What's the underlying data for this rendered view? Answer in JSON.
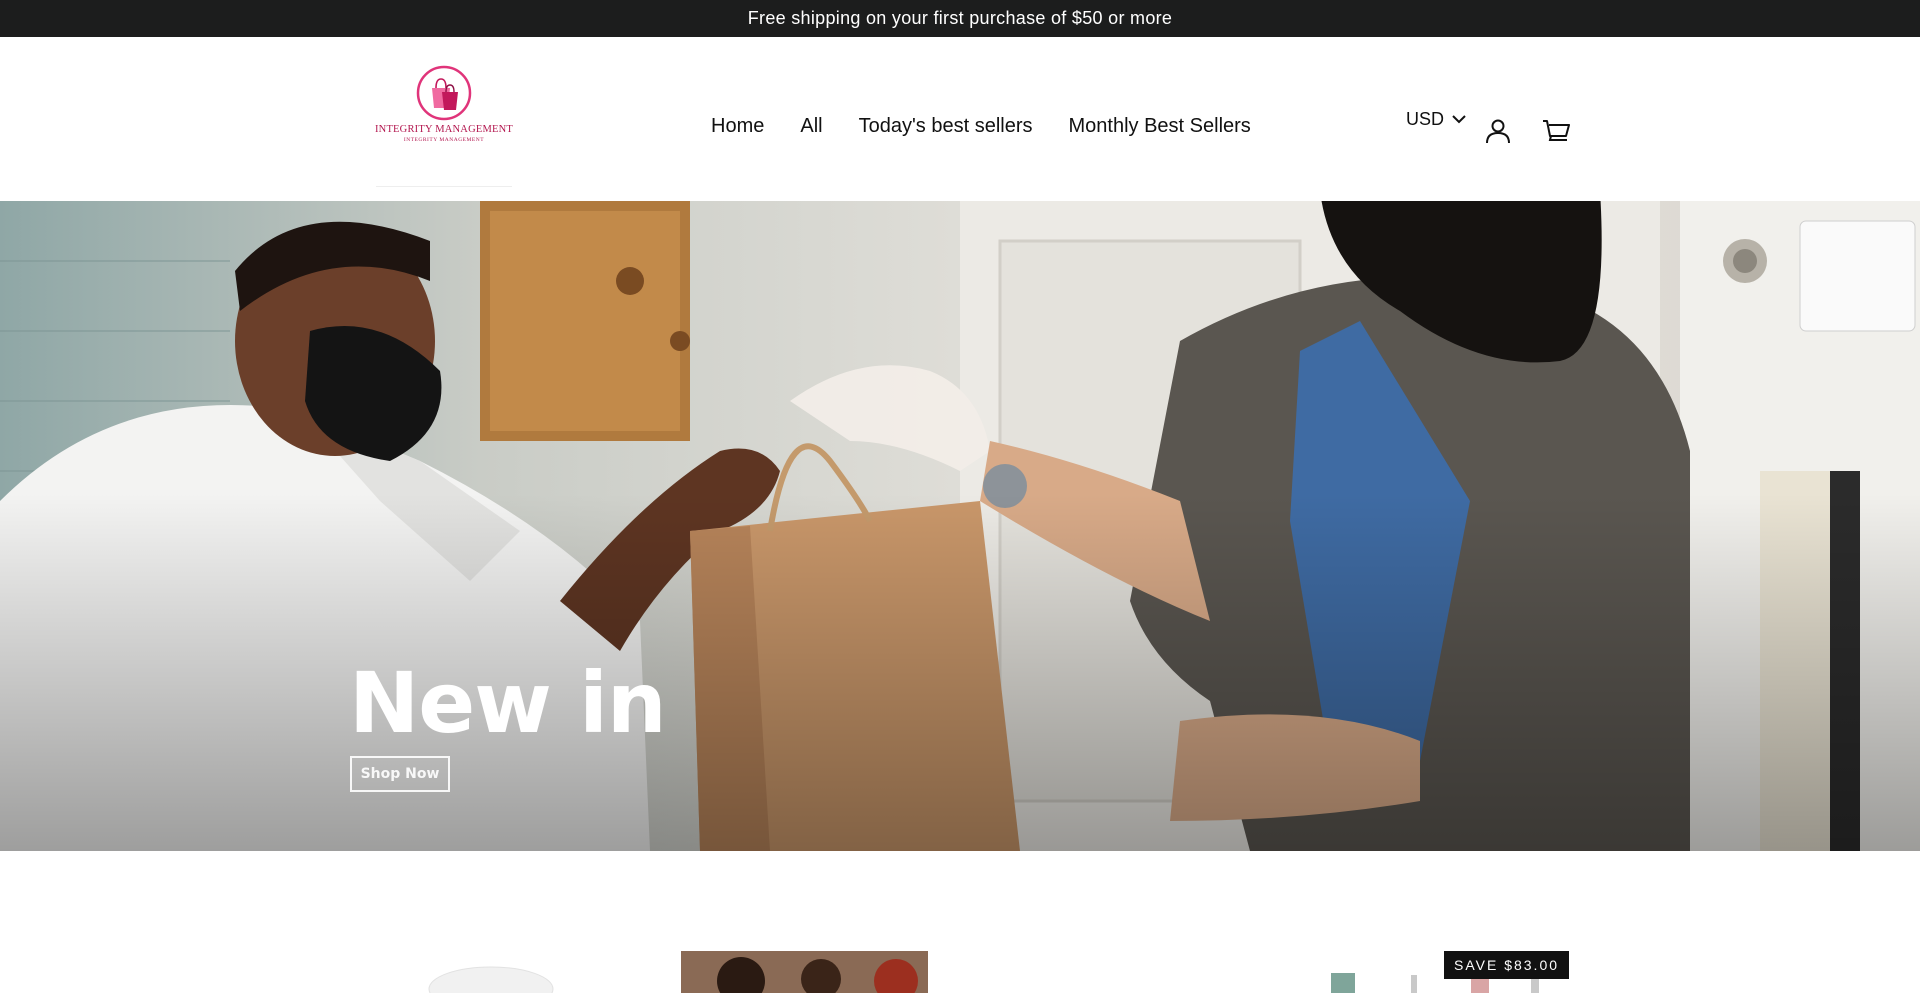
{
  "announcement": {
    "text": "Free shipping on your first purchase of $50 or more"
  },
  "logo": {
    "name": "INTEGRITY MANAGEMENT",
    "subtext": "INTEGRITY MANAGEMENT",
    "accent_color": "#e0347a"
  },
  "nav": {
    "items": [
      {
        "label": "Home"
      },
      {
        "label": "All"
      },
      {
        "label": "Today's best sellers"
      },
      {
        "label": "Monthly Best Sellers"
      }
    ]
  },
  "header_actions": {
    "currency": "USD",
    "account_icon": "user-icon",
    "cart_icon": "cart-icon"
  },
  "hero": {
    "title": "New in",
    "button_label": "Shop Now"
  },
  "products": {
    "badge": "SAVE $83.00"
  },
  "colors": {
    "announcement_bg": "#1c1d1d",
    "badge_bg": "#111111"
  }
}
